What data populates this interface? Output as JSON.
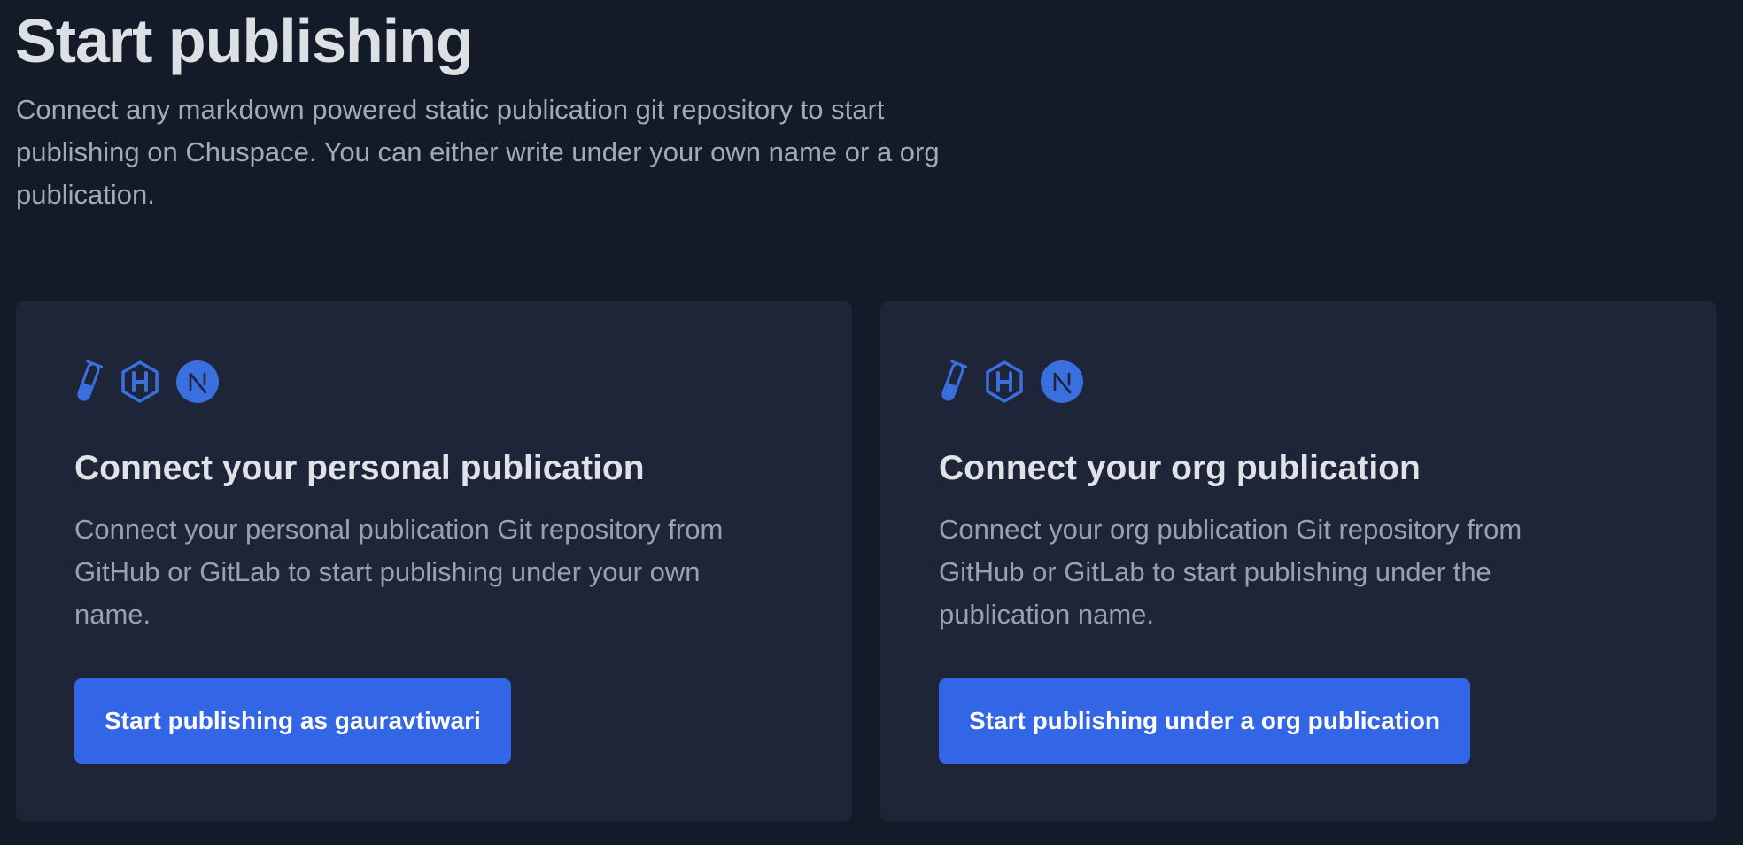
{
  "header": {
    "title": "Start publishing",
    "intro": "Connect any markdown powered static publication git repository to start publishing on Chuspace. You can either write under your own name or a org publication."
  },
  "colors": {
    "background": "#131a28",
    "card": "#1e2539",
    "accent": "#3366e6"
  },
  "cards": [
    {
      "icons": [
        "test-tube-icon",
        "hexo-icon",
        "nextjs-icon"
      ],
      "title": "Connect your personal publication",
      "description": "Connect your personal publication Git repository from GitHub or GitLab to start publishing under your own name.",
      "button_label": "Start publishing as gauravtiwari"
    },
    {
      "icons": [
        "test-tube-icon",
        "hexo-icon",
        "nextjs-icon"
      ],
      "title": "Connect your org publication",
      "description": "Connect your org publication Git repository from GitHub or GitLab to start publishing under the publication name.",
      "button_label": "Start publishing under a org publication"
    }
  ]
}
